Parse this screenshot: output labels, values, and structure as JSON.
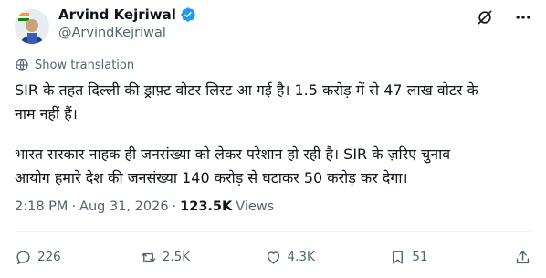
{
  "author": {
    "name": "Arvind Kejriwal",
    "handle": "@ArvindKejriwal",
    "verified": true
  },
  "translation": {
    "label": "Show translation"
  },
  "body": {
    "paragraph1_line1": "SIR के तहत दिल्ली की ड्राफ़्ट वोटर लिस्ट आ गई है। 1.5 करोड़ में से 47 लाख वोटर के",
    "paragraph1_line2": "नाम नहीं हैं।",
    "paragraph2_line1": "भारत सरकार नाहक ही जनसंख्या को लेकर परेशान हो रही है। SIR के ज़रिए चुनाव",
    "paragraph2_line2": "आयोग हमारे देश की जनसंख्या 140 करोड़ से घटाकर 50 करोड़ कर देगा।"
  },
  "meta": {
    "time": "2:18 PM",
    "separator": "·",
    "date": "Aug 31, 2026",
    "views_count": "123.5K",
    "views_label": "Views"
  },
  "actions": {
    "replies": "226",
    "reposts": "2.5K",
    "likes": "4.3K",
    "bookmarks": "51"
  },
  "icons": {
    "verified": "verified-badge-icon",
    "grok": "grok-icon",
    "more": "more-icon",
    "translate": "globe-icon",
    "reply": "reply-icon",
    "repost": "repost-icon",
    "like": "heart-icon",
    "bookmark": "bookmark-icon",
    "share": "share-icon"
  },
  "colors": {
    "text_primary": "#0f1419",
    "text_secondary": "#536471",
    "verified_blue": "#1d9bf0",
    "divider": "#eff3f4"
  }
}
